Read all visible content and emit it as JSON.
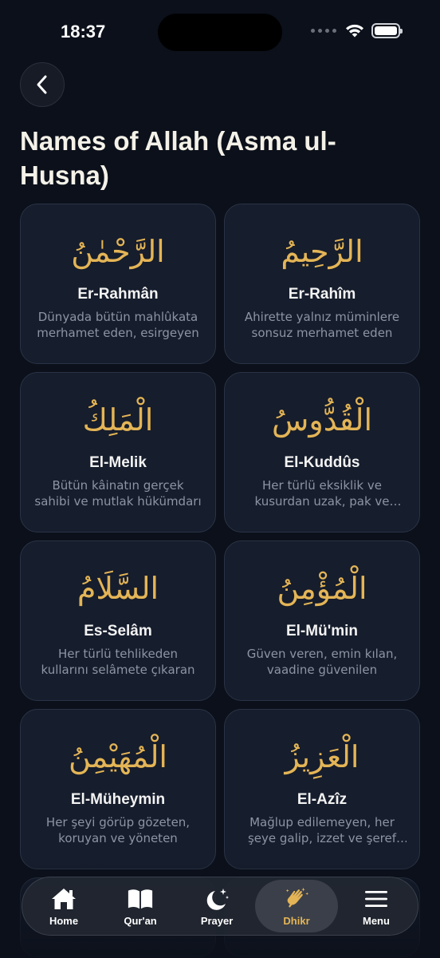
{
  "status_bar": {
    "time": "18:37"
  },
  "header": {
    "title": "Names of Allah (Asma ul-Husna)"
  },
  "names": [
    {
      "arabic": "الرَّحْمٰنُ",
      "name": "Er-Rahmân",
      "description": "Dünyada bütün mahlûkata merhamet eden, esirgeyen"
    },
    {
      "arabic": "الرَّحِيمُ",
      "name": "Er-Rahîm",
      "description": "Ahirette yalnız müminlere sonsuz merhamet eden"
    },
    {
      "arabic": "الْمَلِكُ",
      "name": "El-Melik",
      "description": "Bütün kâinatın gerçek sahibi ve mutlak hükümdarı"
    },
    {
      "arabic": "الْقُدُّوسُ",
      "name": "El-Kuddûs",
      "description": "Her türlü eksiklik ve kusurdan uzak, pak ve temiz"
    },
    {
      "arabic": "السَّلَامُ",
      "name": "Es-Selâm",
      "description": "Her türlü tehlikeden kullarını selâmete çıkaran"
    },
    {
      "arabic": "الْمُؤْمِنُ",
      "name": "El-Mü'min",
      "description": "Güven veren, emin kılan, vaadine güvenilen"
    },
    {
      "arabic": "الْمُهَيْمِنُ",
      "name": "El-Müheymin",
      "description": "Her şeyi görüp gözeten, koruyan ve yöneten"
    },
    {
      "arabic": "الْعَزِيزُ",
      "name": "El-Azîz",
      "description": "Mağlup edilemeyen, her şeye galip, izzet ve şeref sahibi"
    }
  ],
  "tabs": [
    {
      "label": "Home",
      "icon": "home-icon"
    },
    {
      "label": "Qur'an",
      "icon": "book-icon"
    },
    {
      "label": "Prayer",
      "icon": "moon-icon"
    },
    {
      "label": "Dhikr",
      "icon": "hands-icon",
      "active": true
    },
    {
      "label": "Menu",
      "icon": "menu-icon"
    }
  ],
  "colors": {
    "accent": "#e4b556",
    "background": "#0b101a",
    "card": "#161d2c"
  }
}
